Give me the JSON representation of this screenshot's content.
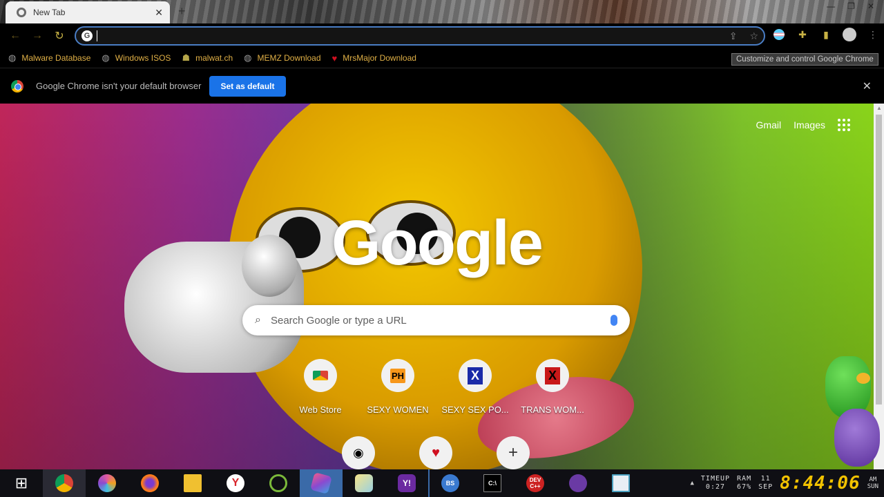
{
  "tab": {
    "title": "New Tab",
    "close": "✕",
    "new_tab": "+"
  },
  "window_controls": {
    "minimize": "—",
    "restore": "❐",
    "close": "✕"
  },
  "nav": {
    "back": "←",
    "forward": "→",
    "reload": "↻"
  },
  "omnibox": {
    "value": "",
    "share": "⇪",
    "bookmark": "☆"
  },
  "bookmarks": [
    {
      "label": "Malware Database",
      "icon": "globe-icon"
    },
    {
      "label": "Windows ISOS",
      "icon": "globe-icon"
    },
    {
      "label": "malwat.ch",
      "icon": "skull-icon"
    },
    {
      "label": "MEMZ Download",
      "icon": "globe-icon"
    },
    {
      "label": "MrsMajor Download",
      "icon": "heart-icon"
    }
  ],
  "tooltip": "Customize and control Google Chrome",
  "infobar": {
    "message": "Google Chrome isn't your default browser",
    "button": "Set as default",
    "close": "✕"
  },
  "top_links": {
    "gmail": "Gmail",
    "images": "Images"
  },
  "logo": "Google",
  "search": {
    "placeholder": "Search Google or type a URL"
  },
  "shortcuts": [
    {
      "label": "Web Store",
      "badge": ""
    },
    {
      "label": "SEXY WOMEN",
      "badge": "PH"
    },
    {
      "label": "SEXY SEX PO...",
      "badge": "X"
    },
    {
      "label": "TRANS WOM...",
      "badge": "X"
    }
  ],
  "shortcuts_row2": {
    "add": "+"
  },
  "taskbar": {
    "start": "⊞",
    "apps": [
      {
        "name": "chrome",
        "color": "#db4437",
        "active": true
      },
      {
        "name": "pinwheel",
        "color": "#e05aa0"
      },
      {
        "name": "firefox",
        "color": "#ff7b1a"
      },
      {
        "name": "file-explorer",
        "color": "#f0c030"
      },
      {
        "name": "yandex",
        "color": "#d8262c"
      },
      {
        "name": "green-app",
        "color": "#7bb93a"
      },
      {
        "name": "gem-app",
        "color": "#c04aa0",
        "active": true
      },
      {
        "name": "notes-app",
        "color": "#9ad0e0"
      },
      {
        "name": "yahoo",
        "color": "#6b2aa0"
      },
      {
        "name": "bluestacks",
        "color": "#3a7ad0"
      },
      {
        "name": "terminal",
        "color": "#222222"
      },
      {
        "name": "dev-cpp",
        "color": "#c22"
      },
      {
        "name": "bonzi",
        "color": "#6a3aa4"
      },
      {
        "name": "notepad",
        "color": "#4aa0c0"
      }
    ]
  },
  "tray": {
    "timeup_label": "TIMEUP",
    "timeup_value": "0:27",
    "ram_label": "RAM",
    "ram_value": "67%",
    "date_day": "11",
    "date_month": "SEP",
    "clock": "8:44:06",
    "ampm": "AM",
    "weekday": "SUN"
  }
}
